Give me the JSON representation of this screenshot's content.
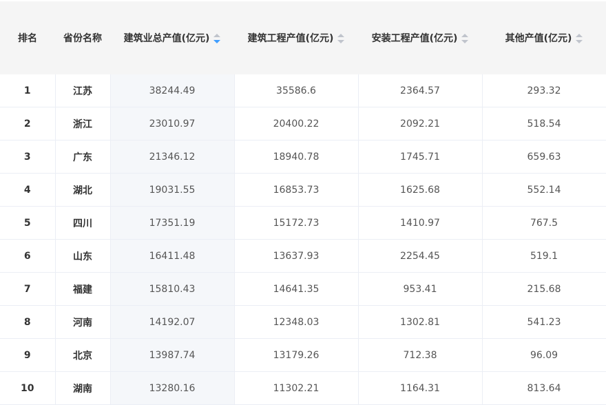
{
  "headers": {
    "rank": "排名",
    "province": "省份名称",
    "total": "建筑业总产值(亿元)",
    "construction": "建筑工程产值(亿元)",
    "installation": "安装工程产值(亿元)",
    "other": "其他产值(亿元)"
  },
  "sort_active_column": "total",
  "sort_active_direction": "descending",
  "accent_color": "#409eff",
  "rows": [
    {
      "rank": "1",
      "province": "江苏",
      "total": "38244.49",
      "construction": "35586.6",
      "installation": "2364.57",
      "other": "293.32"
    },
    {
      "rank": "2",
      "province": "浙江",
      "total": "23010.97",
      "construction": "20400.22",
      "installation": "2092.21",
      "other": "518.54"
    },
    {
      "rank": "3",
      "province": "广东",
      "total": "21346.12",
      "construction": "18940.78",
      "installation": "1745.71",
      "other": "659.63"
    },
    {
      "rank": "4",
      "province": "湖北",
      "total": "19031.55",
      "construction": "16853.73",
      "installation": "1625.68",
      "other": "552.14"
    },
    {
      "rank": "5",
      "province": "四川",
      "total": "17351.19",
      "construction": "15172.73",
      "installation": "1410.97",
      "other": "767.5"
    },
    {
      "rank": "6",
      "province": "山东",
      "total": "16411.48",
      "construction": "13637.93",
      "installation": "2254.45",
      "other": "519.1"
    },
    {
      "rank": "7",
      "province": "福建",
      "total": "15810.43",
      "construction": "14641.35",
      "installation": "953.41",
      "other": "215.68"
    },
    {
      "rank": "8",
      "province": "河南",
      "total": "14192.07",
      "construction": "12348.03",
      "installation": "1302.81",
      "other": "541.23"
    },
    {
      "rank": "9",
      "province": "北京",
      "total": "13987.74",
      "construction": "13179.26",
      "installation": "712.38",
      "other": "96.09"
    },
    {
      "rank": "10",
      "province": "湖南",
      "total": "13280.16",
      "construction": "11302.21",
      "installation": "1164.31",
      "other": "813.64"
    }
  ]
}
